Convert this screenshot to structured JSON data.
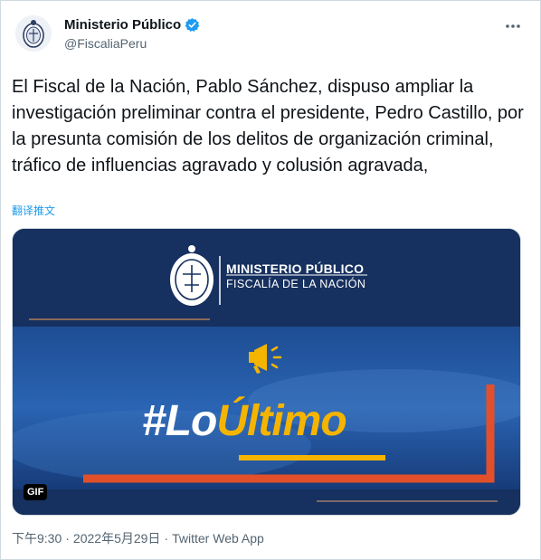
{
  "tweet": {
    "author_name": "Ministerio Público",
    "author_handle": "@FiscaliaPeru",
    "text": "El Fiscal de la Nación, Pablo Sánchez, dispuso ampliar la investigación preliminar contra el presidente, Pedro Castillo, por la presunta comisión de los delitos de organización criminal, tráfico de influencias agravado y colusión agravada,",
    "translate_label": "翻译推文",
    "time": "下午9:30",
    "date": "2022年5月29日",
    "source": "Twitter Web App",
    "separator": "·"
  },
  "media": {
    "gif_label": "GIF",
    "logo_title": "MINISTERIO PÚBLICO",
    "logo_subtitle": "FISCALÍA DE LA NACIÓN",
    "hashtag_white": "#Lo",
    "hashtag_yellow": "Último"
  },
  "colors": {
    "verified": "#1d9bf0",
    "link": "#1d9bf0",
    "media_bg": "#16305f",
    "accent_red": "#e2502b",
    "accent_yellow": "#f5b400"
  },
  "icons": {
    "verified": "verified-badge-icon",
    "more": "more-dots-icon",
    "megaphone": "megaphone-icon",
    "seal": "seal-logo"
  }
}
